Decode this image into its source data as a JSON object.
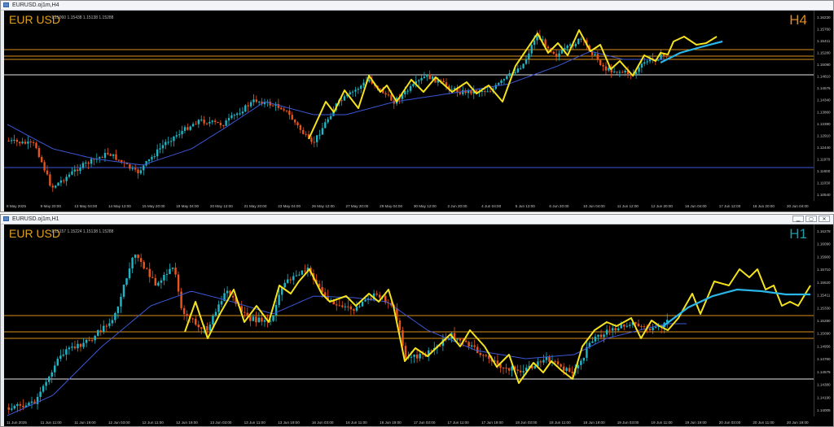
{
  "top": {
    "window_title": "EURUSD.oj1m,H4",
    "symbol": "EUR USD",
    "timeframe": "H4",
    "timeframe_color": "#e08a1e",
    "ohlc": "1.15060 1.15438 1.15138 1.15288",
    "price_labels": [
      "1.16230",
      "1.15760",
      "1.15411",
      "1.15280",
      "1.15090",
      "1.14810",
      "1.14576",
      "1.14340",
      "1.13860",
      "1.13390",
      "1.12910",
      "1.12440",
      "1.11970",
      "1.11500",
      "1.11030",
      "1.10540"
    ],
    "time_labels": [
      "8 May 2025",
      "9 May 20:00",
      "13 May 04:00",
      "14 May 12:00",
      "15 May 20:00",
      "19 May 04:00",
      "20 May 12:00",
      "21 May 20:00",
      "23 May 04:00",
      "26 May 12:00",
      "27 May 20:00",
      "29 May 04:00",
      "30 May 12:00",
      "2 Jun 20:00",
      "4 Jun 04:00",
      "5 Jun 12:00",
      "6 Jun 20:00",
      "10 Jun 04:00",
      "11 Jun 12:00",
      "12 Jun 20:00",
      "16 Jun 04:00",
      "17 Jun 12:00",
      "18 Jun 20:00",
      "20 Jun 04:00"
    ]
  },
  "bottom": {
    "window_title": "EURUSD.oj1m,H1",
    "symbol": "EUR USD",
    "timeframe": "H1",
    "timeframe_color": "#1e9aa8",
    "ohlc": "1.15157 1.15224 1.15138 1.15288",
    "price_labels": [
      "1.16278",
      "1.16090",
      "1.15900",
      "1.15710",
      "1.15520",
      "1.15411",
      "1.15330",
      "1.15280",
      "1.15090",
      "1.14956",
      "1.14760",
      "1.14576",
      "1.14380",
      "1.14190",
      "1.14005"
    ],
    "time_labels": [
      "11 Jun 2025",
      "11 Jun 11:00",
      "11 Jun 19:00",
      "12 Jun 03:00",
      "12 Jun 11:00",
      "12 Jun 19:00",
      "13 Jun 03:00",
      "13 Jun 11:00",
      "13 Jun 19:00",
      "16 Jun 03:00",
      "16 Jun 11:00",
      "16 Jun 19:00",
      "17 Jun 03:00",
      "17 Jun 11:00",
      "17 Jun 19:00",
      "18 Jun 03:00",
      "18 Jun 11:00",
      "18 Jun 19:00",
      "19 Jun 03:00",
      "19 Jun 11:00",
      "19 Jun 19:00",
      "20 Jun 03:00",
      "20 Jun 11:00",
      "20 Jun 19:00"
    ]
  },
  "colors": {
    "bull": "#1fb5c4",
    "bear": "#e8541e",
    "ma": "#3b57d6",
    "overlay": "#f4e21c",
    "projection": "#29b6e8",
    "orange_line": "#d9901c",
    "white_line": "#e6e6e6"
  },
  "icons": [
    "minimize-icon",
    "maximize-icon",
    "close-icon"
  ]
}
